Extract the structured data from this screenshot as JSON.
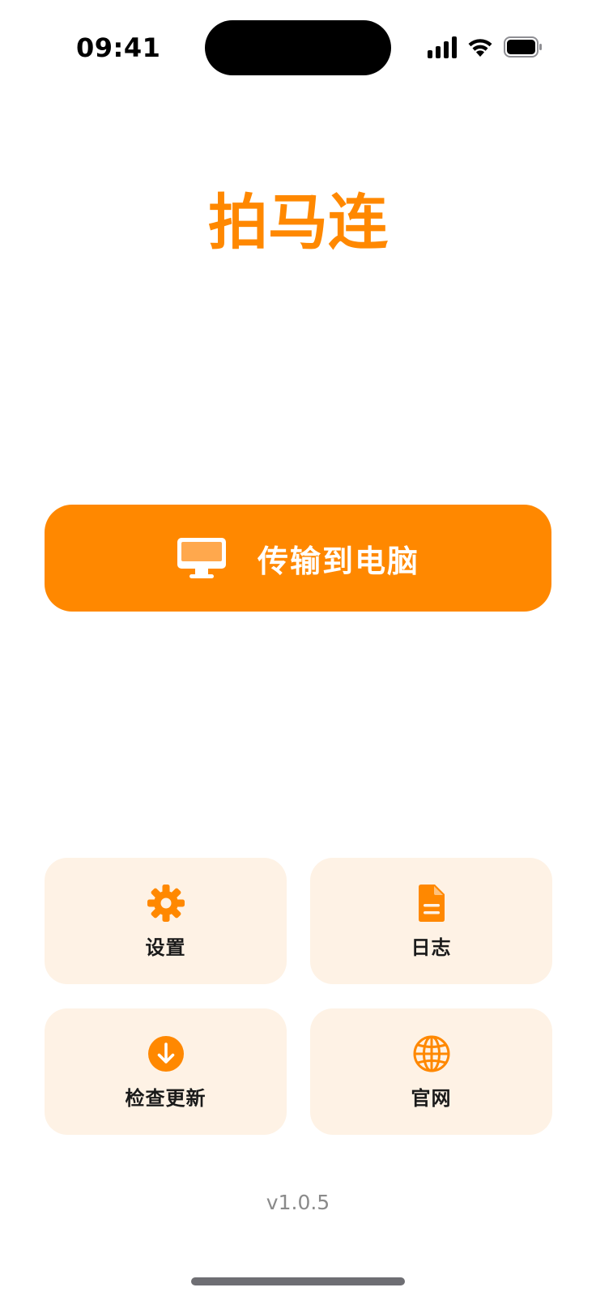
{
  "status_bar": {
    "time": "09:41"
  },
  "app": {
    "title": "拍马连",
    "accent_color": "#FF8800",
    "tile_bg_color": "#FEF2E5"
  },
  "main_action": {
    "label": "传输到电脑",
    "icon": "desktop-computer-icon"
  },
  "tiles": [
    {
      "label": "设置",
      "icon": "gear-icon"
    },
    {
      "label": "日志",
      "icon": "document-icon"
    },
    {
      "label": "检查更新",
      "icon": "download-circle-icon"
    },
    {
      "label": "官网",
      "icon": "globe-icon"
    }
  ],
  "footer": {
    "version": "v1.0.5"
  }
}
